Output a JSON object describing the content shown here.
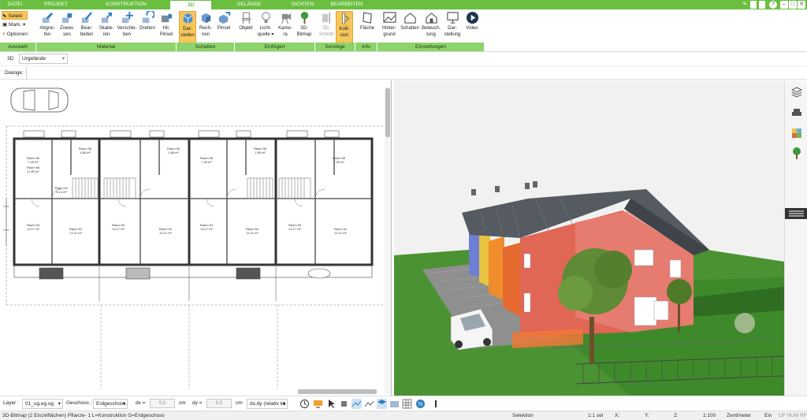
{
  "menu_tabs": [
    {
      "label": "DATEI"
    },
    {
      "label": "PROJEKT"
    },
    {
      "label": "KONSTRUKTION"
    },
    {
      "label": "3D"
    },
    {
      "label": "GELÄNDE"
    },
    {
      "label": "SICHTEN"
    },
    {
      "label": "BEARBEITEN"
    }
  ],
  "window_controls": {
    "help": "?",
    "minimize": "–",
    "maximize": "□",
    "close": "✕"
  },
  "ribbon": {
    "auswahl": {
      "selekt": "Selekt",
      "mark": "Mark.",
      "optionen": "Optionen"
    },
    "material": [
      {
        "line1": "Abgrei-",
        "line2": "fen"
      },
      {
        "line1": "Zuwei-",
        "line2": "sen"
      },
      {
        "line1": "Bear-",
        "line2": "beiten"
      },
      {
        "line1": "Skalie-",
        "line2": "ren"
      },
      {
        "line1": "Verschie-",
        "line2": "ben"
      },
      {
        "line1": "Drehen",
        "line2": ""
      },
      {
        "line1": "Hil.",
        "line2": "Pinsel"
      }
    ],
    "schatten": [
      {
        "line1": "Dar-",
        "line2": "stellen"
      },
      {
        "line1": "Rech-",
        "line2": "nen"
      },
      {
        "line1": "Pinsel",
        "line2": ""
      }
    ],
    "einfuegen": [
      {
        "line1": "Objekt",
        "line2": ""
      },
      {
        "line1": "Licht-",
        "line2": "quelle ▾"
      },
      {
        "line1": "Kame-",
        "line2": "ra"
      },
      {
        "line1": "3D-",
        "line2": "Bitmap"
      }
    ],
    "sonstige": [
      {
        "line1": "3D-",
        "line2": "Schnitt"
      },
      {
        "line1": "Kolli-",
        "line2": "sion"
      }
    ],
    "info": [
      {
        "line1": "Fläche",
        "line2": ""
      }
    ],
    "einstellungen": [
      {
        "line1": "Hinter-",
        "line2": "grund"
      },
      {
        "line1": "Schatten",
        "line2": ""
      },
      {
        "line1": "Beleuch-",
        "line2": "tung"
      },
      {
        "line1": "Dar-",
        "line2": "stellung"
      },
      {
        "line1": "Video",
        "line2": ""
      }
    ],
    "group_labels": [
      "Auswahl",
      "Material",
      "Schatten",
      "Einfügen",
      "Sonstige",
      "Info",
      "Einstellungen"
    ]
  },
  "view_row": {
    "mode": "3D",
    "terrain_select": "Urgelände"
  },
  "dialog_row": {
    "label": "Dialoge:"
  },
  "plan": {
    "rooms": [
      {
        "name": "Raum 56",
        "area": "1,86 m²"
      },
      {
        "name": "Raum 55",
        "area": "7,45 m²"
      },
      {
        "name": "Raum 66",
        "area": "11,80 m²"
      },
      {
        "name": "Raum 61",
        "area": "5,14 m²"
      },
      {
        "name": "Raum 63",
        "area": "14,17 m²"
      },
      {
        "name": "Raum 62",
        "area": "13,21 m²"
      }
    ]
  },
  "bottom_toolbar": {
    "layer_label": "Layer :",
    "layer_value": "01_ug.eg.og",
    "geschoss_label": "Geschoss :",
    "geschoss_value": "Erdgeschoss",
    "dx_label": "dx =",
    "dx_value": "0,0",
    "dx_unit": "cm",
    "dy_label": "dy =",
    "dy_value": "0,0",
    "dy_unit": "cm",
    "mode_value": "dx,dy (relativ ka"
  },
  "status": {
    "left": "3D-Bitmap (2 Einzelflächen) Pflanze- 1 L=Konstruktion G=Erdgeschoss",
    "mode": "Selektion",
    "scale_sel": "1:1 sel",
    "x": "X:",
    "y": "Y:",
    "z": "Z:",
    "scale": "1:100",
    "unit": "Zentimeter",
    "ein": "Ein",
    "flags": "UF NUM RF"
  },
  "colors": {
    "menu_green": "#6abf40",
    "group_label_green": "#8cd36a",
    "selected_orange": "#f6c65b",
    "icon_blue": "#2f7fc2",
    "house_red": "#e06655",
    "roof_gray": "#555b61",
    "lawn_green": "#3e8a2a"
  }
}
